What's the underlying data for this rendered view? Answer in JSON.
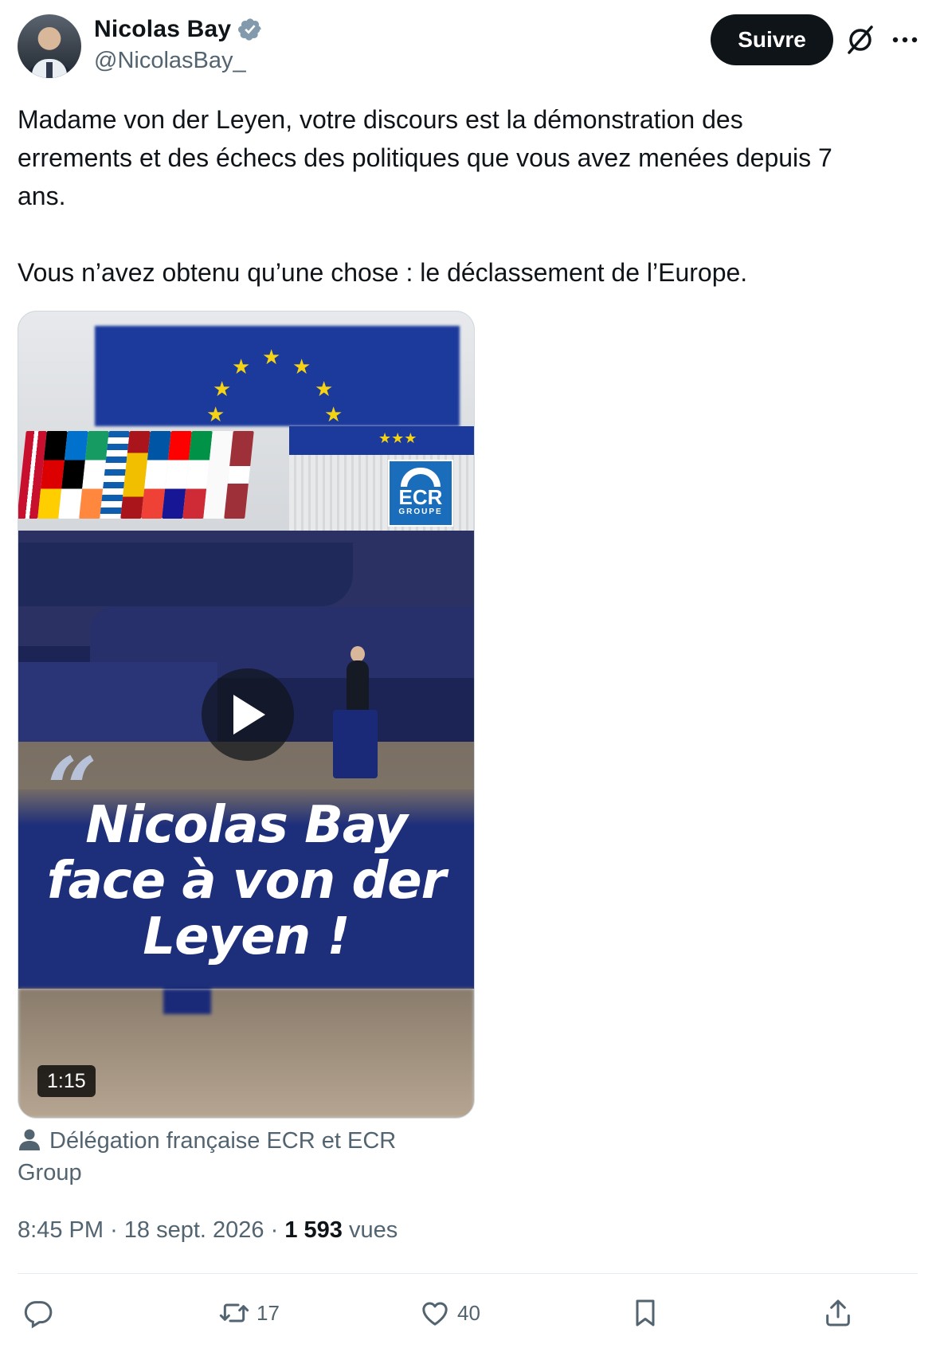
{
  "author": {
    "name": "Nicolas Bay",
    "handle": "@NicolasBay_",
    "verified": true
  },
  "header": {
    "follow_label": "Suivre"
  },
  "tweet": {
    "text": "Madame von der Leyen, votre discours est la démonstration des\nerrements et des échecs des politiques que vous avez menées depuis 7\nans.\n\nVous n’avez obtenu qu’une chose : le déclassement de l’Europe."
  },
  "media": {
    "overlay_title_line1": "Nicolas Bay",
    "overlay_title_line2": "face à von der",
    "overlay_title_line3": "Leyen !",
    "logo_text": "ECR",
    "logo_subtext": "GROUPE",
    "duration": "1:15"
  },
  "attribution": {
    "text": "Délégation française ECR et ECR Group"
  },
  "meta": {
    "time": "8:45 PM",
    "date": "18 sept. 2026",
    "views_count": "1 593",
    "views_label": "vues"
  },
  "actions": {
    "reply_count": "",
    "retweet_count": "17",
    "like_count": "40"
  },
  "colors": {
    "text": "#0f1419",
    "secondary": "#536471",
    "verified": "#829aab",
    "follow_bg": "#0f1419"
  }
}
